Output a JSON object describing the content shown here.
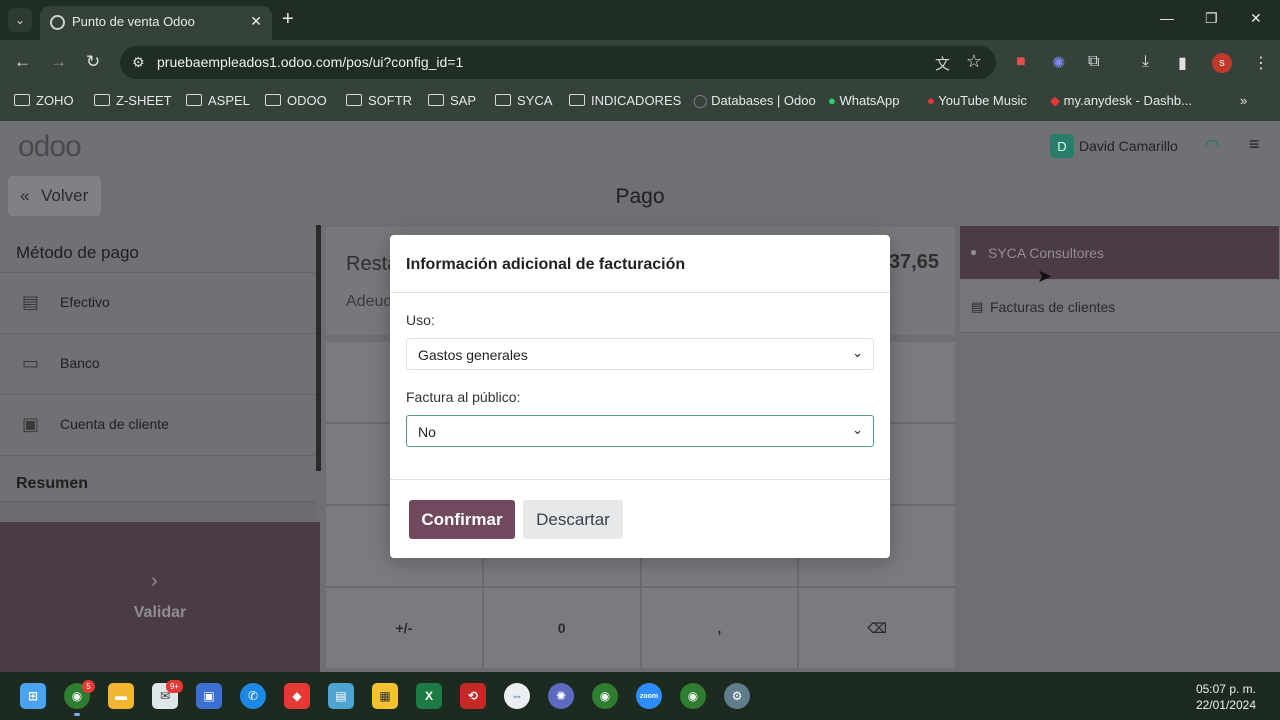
{
  "browser": {
    "tab_title": "Punto de venta Odoo",
    "url": "pruebaempleados1.odoo.com/pos/ui?config_id=1",
    "profile_initial": "s",
    "bookmarks": [
      "ZOHO",
      "Z-SHEET",
      "ASPEL",
      "ODOO",
      "SOFTR",
      "SAP",
      "SYCA",
      "INDICADORES",
      "Databases | Odoo",
      "WhatsApp",
      "YouTube Music",
      "my.anydesk - Dashb..."
    ]
  },
  "header": {
    "logo": "odoo",
    "user_initial": "D",
    "user_name": "David Camarillo"
  },
  "subheader": {
    "back_label": "Volver",
    "page_title": "Pago"
  },
  "left": {
    "payment_title": "Método de pago",
    "methods": [
      "Efectivo",
      "Banco",
      "Cuenta de cliente"
    ],
    "summary_title": "Resumen",
    "validate_label": "Validar"
  },
  "center": {
    "remaining_label": "Resta",
    "due_label": "Adeud",
    "amount": "37,65",
    "keys": [
      "",
      "",
      "",
      "",
      "",
      "",
      "",
      "",
      "",
      "",
      "",
      "",
      "+/-",
      "0",
      ",",
      "⌫"
    ]
  },
  "right": {
    "customer": "SYCA Consultores",
    "invoice_label": "Facturas de clientes"
  },
  "modal": {
    "title": "Información adicional de facturación",
    "uso_label": "Uso:",
    "uso_value": "Gastos generales",
    "factura_label": "Factura al público:",
    "factura_value": "No",
    "confirm_label": "Confirmar",
    "discard_label": "Descartar"
  },
  "taskbar": {
    "time": "05:07 p. m.",
    "date": "22/01/2024",
    "badge_chrome": "5",
    "badge_chat": "9+"
  },
  "colors": {
    "accent": "#71495f",
    "validate_bg": "#4c3a47",
    "overlay_bg": "#6f7074"
  }
}
